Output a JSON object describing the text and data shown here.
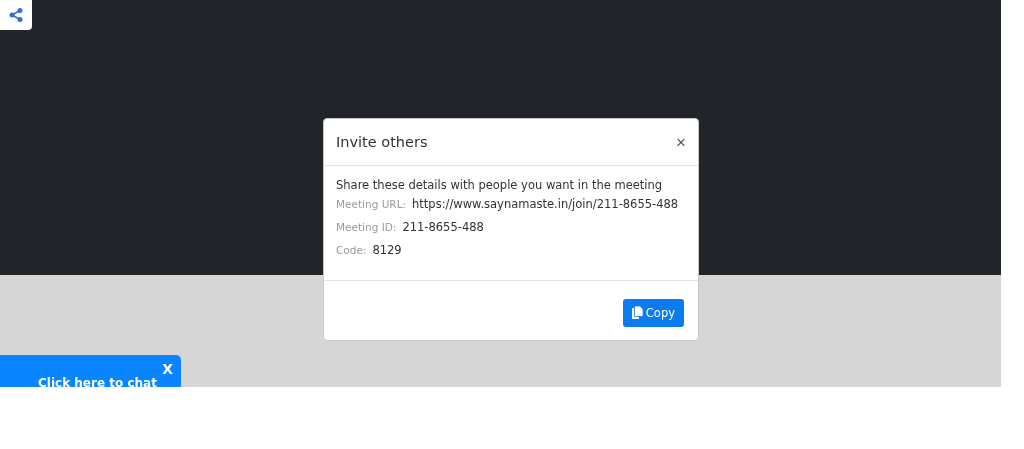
{
  "share_button": {
    "kind": "share"
  },
  "modal": {
    "title": "Invite others",
    "close": "×",
    "intro": "Share these details with people you want in the meeting",
    "details": [
      {
        "label": "Meeting URL:",
        "value": "https://www.saynamaste.in/join/211-8655-488"
      },
      {
        "label": "Meeting ID:",
        "value": "211-8655-488"
      },
      {
        "label": "Code:",
        "value": "8129"
      }
    ],
    "buttons": [
      {
        "label": "Copy"
      }
    ]
  },
  "chat_widget": {
    "label": "Click here to chat",
    "close": "X"
  }
}
